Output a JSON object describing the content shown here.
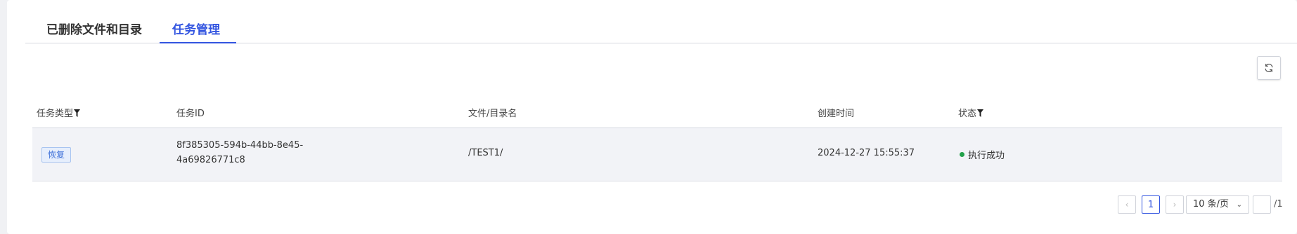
{
  "tabs": [
    {
      "label": "已删除文件和目录",
      "active": false
    },
    {
      "label": "任务管理",
      "active": true
    }
  ],
  "table": {
    "columns": [
      "任务类型",
      "任务ID",
      "文件/目录名",
      "创建时间",
      "状态"
    ],
    "rows": [
      {
        "type": "恢复",
        "task_id_line1": "8f385305-594b-44bb-8e45-",
        "task_id_line2": "4a69826771c8",
        "name": "/TEST1/",
        "created": "2024-12-27 15:55:37",
        "status": "执行成功"
      }
    ]
  },
  "pagination": {
    "prev": "‹",
    "current_page": "1",
    "next": "›",
    "page_size": "10 条/页",
    "jump_value": "",
    "total": "/1"
  },
  "colors": {
    "accent": "#3355e0",
    "success": "#22a14a",
    "badge_text": "#3d6fd8"
  },
  "icons": {
    "refresh": "refresh-icon",
    "filter": "filter-icon"
  }
}
